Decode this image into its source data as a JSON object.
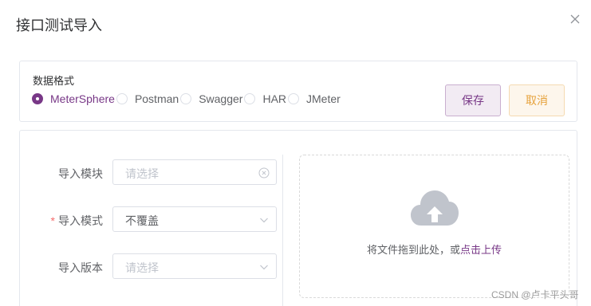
{
  "dialog": {
    "title": "接口测试导入"
  },
  "format": {
    "label": "数据格式",
    "options": [
      {
        "label": "MeterSphere",
        "checked": true
      },
      {
        "label": "Postman",
        "checked": false
      },
      {
        "label": "Swagger",
        "checked": false
      },
      {
        "label": "HAR",
        "checked": false
      },
      {
        "label": "JMeter",
        "checked": false
      }
    ],
    "save_label": "保存",
    "cancel_label": "取消"
  },
  "form": {
    "module": {
      "label": "导入模块",
      "placeholder": "请选择"
    },
    "mode": {
      "label": "导入模式",
      "required_mark": "*",
      "value": "不覆盖"
    },
    "version": {
      "label": "导入版本",
      "placeholder": "请选择"
    }
  },
  "upload": {
    "text_prefix": "将文件拖到此处，或",
    "link_text": "点击上传"
  },
  "watermark": "CSDN @卢卡平头哥",
  "colors": {
    "primary": "#783887",
    "warning": "#e6a23c",
    "required": "#f56c6c",
    "cloud_icon": "#c0c4cc"
  },
  "icons": {
    "close": "close-icon",
    "clear": "circle-close-icon",
    "arrow": "chevron-down-icon",
    "upload": "cloud-upload-icon"
  }
}
